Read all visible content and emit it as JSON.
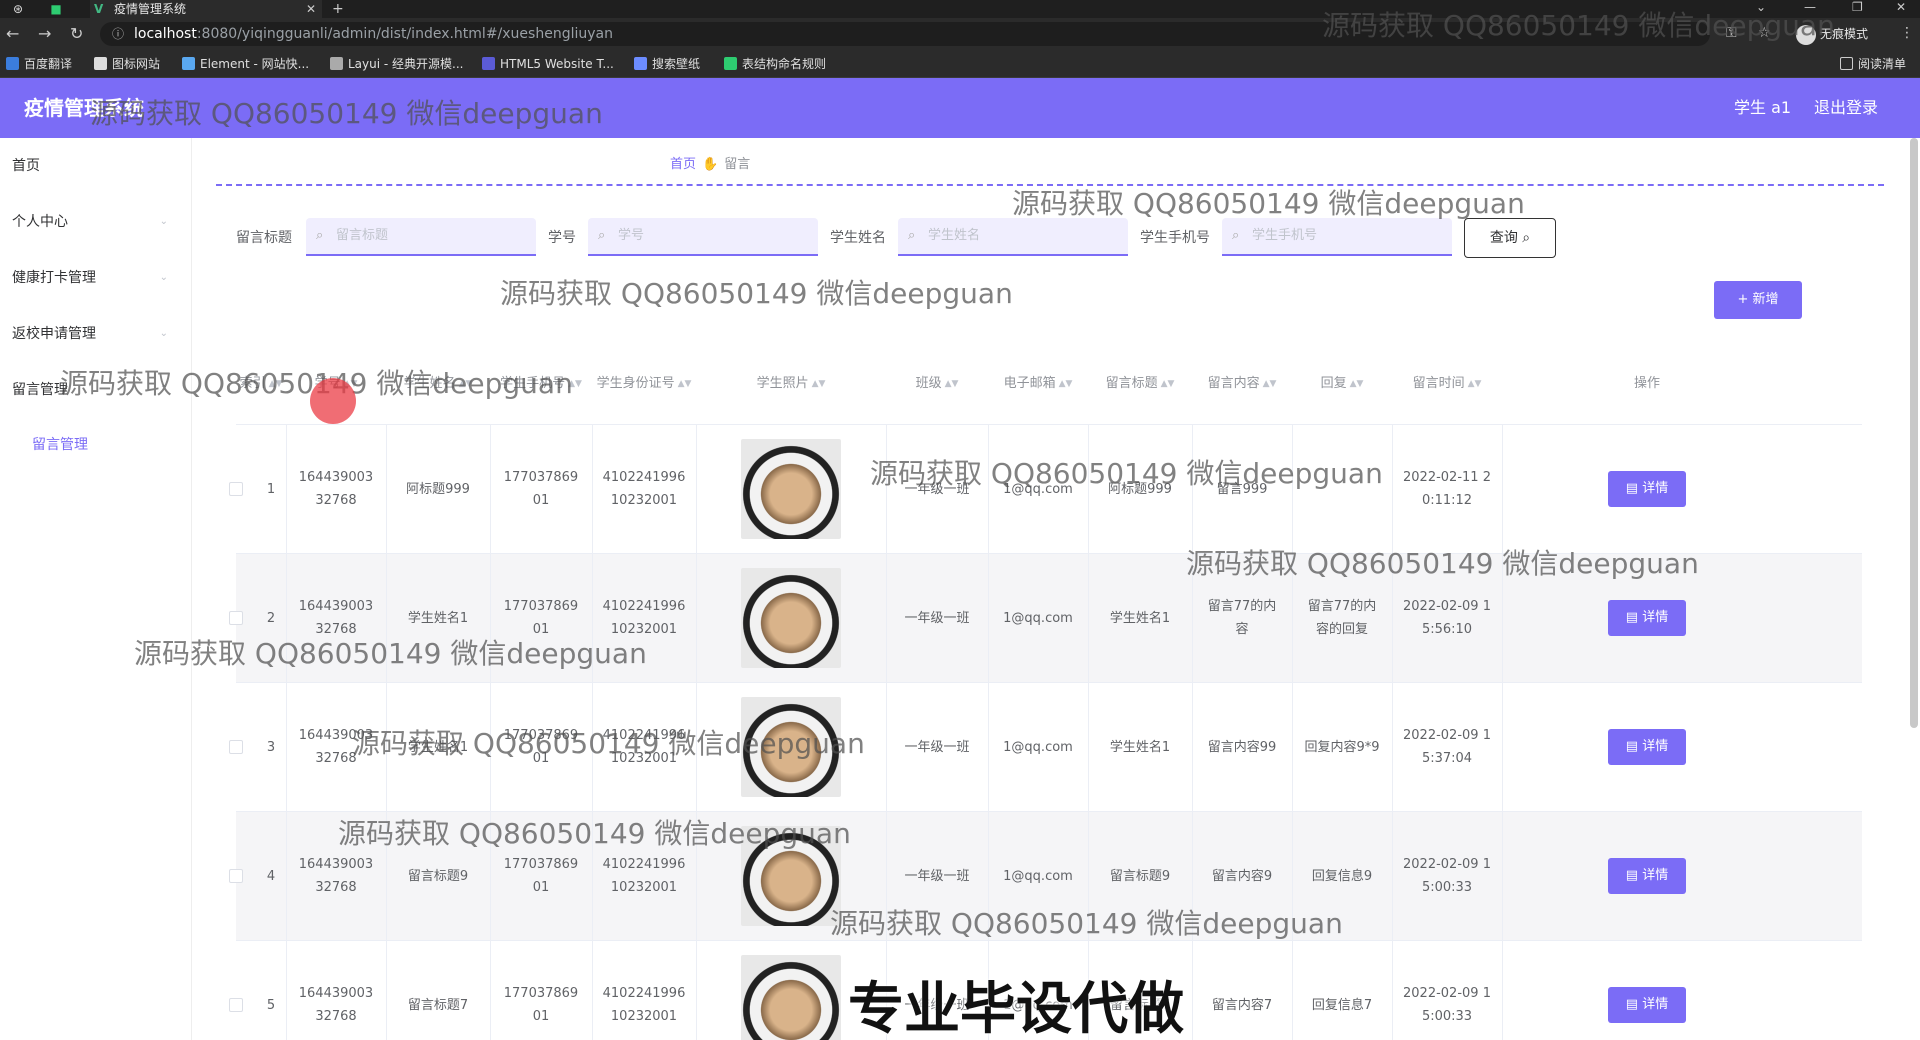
{
  "browser": {
    "tab_title": "疫情管理系统",
    "url_host": "localhost",
    "url_path": ":8080/yiqingguanli/admin/dist/index.html#/xueshengliuyan",
    "incognito_label": "无痕模式",
    "reading_list": "阅读清单",
    "bookmarks": [
      "百度翻译",
      "图标网站",
      "Element - 网站快...",
      "Layui - 经典开源模...",
      "HTML5 Website T...",
      "搜索壁纸",
      "表结构命名规则"
    ]
  },
  "header": {
    "title": "疫情管理系统",
    "user": "学生 a1",
    "logout": "退出登录"
  },
  "sidebar": {
    "items": [
      {
        "label": "首页"
      },
      {
        "label": "个人中心"
      },
      {
        "label": "健康打卡管理"
      },
      {
        "label": "返校申请管理"
      },
      {
        "label": "留言管理"
      }
    ],
    "sub_item": "留言管理"
  },
  "breadcrumb": {
    "home": "首页",
    "current": "留言"
  },
  "filters": [
    {
      "label": "留言标题",
      "placeholder": "留言标题"
    },
    {
      "label": "学号",
      "placeholder": "学号"
    },
    {
      "label": "学生姓名",
      "placeholder": "学生姓名"
    },
    {
      "label": "学生手机号",
      "placeholder": "学生手机号"
    }
  ],
  "query_button": "查询",
  "add_button": "+ 新增",
  "table": {
    "columns": [
      "索引",
      "学号",
      "学生姓名",
      "学生手机号",
      "学生身份证号",
      "学生照片",
      "班级",
      "电子邮箱",
      "留言标题",
      "留言内容",
      "回复",
      "留言时间",
      "操作"
    ],
    "detail_label": "详情",
    "rows": [
      {
        "index": "1",
        "student_no": "16443900332768",
        "name": "阿标题999",
        "phone": "17703786901",
        "id_no": "410224199610232001",
        "class": "一年级一班",
        "email": "1@qq.com",
        "title": "阿标题999",
        "content": "留言999",
        "reply": "",
        "time": "2022-02-11 20:11:12"
      },
      {
        "index": "2",
        "student_no": "16443900332768",
        "name": "学生姓名1",
        "phone": "17703786901",
        "id_no": "410224199610232001",
        "class": "一年级一班",
        "email": "1@qq.com",
        "title": "学生姓名1",
        "content": "留言77的内容",
        "reply": "留言77的内容的回复",
        "time": "2022-02-09 15:56:10"
      },
      {
        "index": "3",
        "student_no": "16443900332768",
        "name": "学生姓名1",
        "phone": "17703786901",
        "id_no": "410224199610232001",
        "class": "一年级一班",
        "email": "1@qq.com",
        "title": "学生姓名1",
        "content": "留言内容99",
        "reply": "回复内容9*9",
        "time": "2022-02-09 15:37:04"
      },
      {
        "index": "4",
        "student_no": "16443900332768",
        "name": "留言标题9",
        "phone": "17703786901",
        "id_no": "410224199610232001",
        "class": "一年级一班",
        "email": "1@qq.com",
        "title": "留言标题9",
        "content": "留言内容9",
        "reply": "回复信息9",
        "time": "2022-02-09 15:00:33"
      },
      {
        "index": "5",
        "student_no": "16443900332768",
        "name": "留言标题7",
        "phone": "17703786901",
        "id_no": "410224199610232001",
        "class": "一年级一班",
        "email": "1@qq.com",
        "title": "留言标题7",
        "content": "留言内容7",
        "reply": "回复信息7",
        "time": "2022-02-09 15:00:33"
      }
    ]
  },
  "watermark": {
    "text": "源码获取 QQ86050149 微信deepguan",
    "big": "专业毕设代做"
  }
}
